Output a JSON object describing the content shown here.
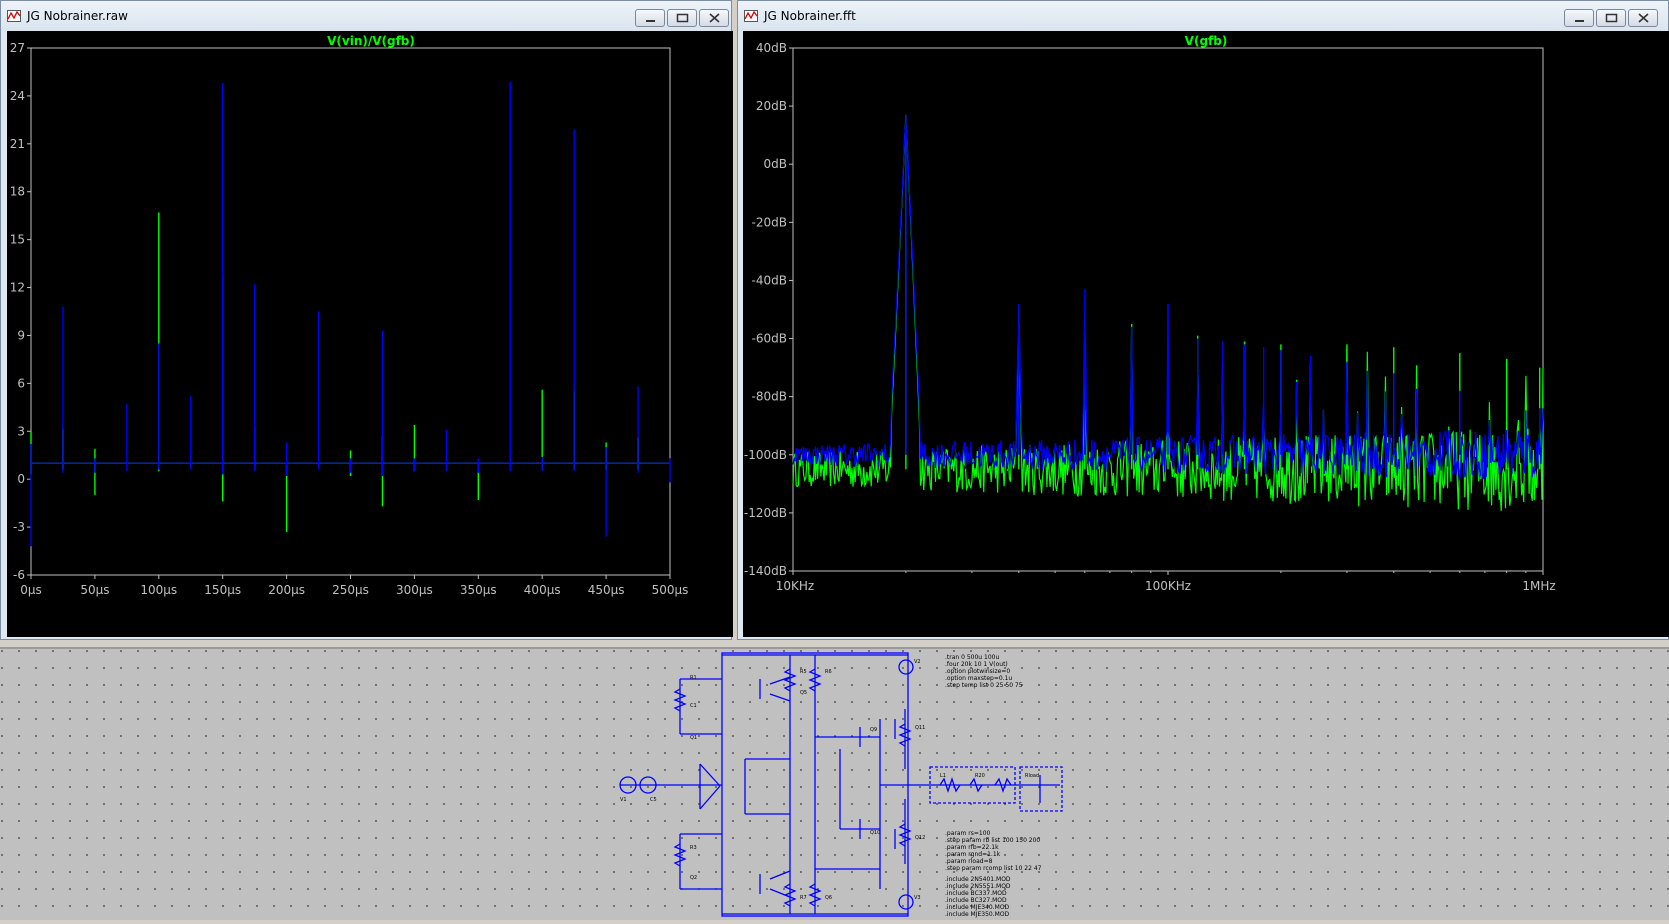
{
  "colors": {
    "plot_bg": "#000000",
    "axis": "#c0c0c0",
    "trace_green": "#00ff00",
    "trace_blue": "#0000ff",
    "wire": "#0000ff",
    "schematic_bg": "#c0c0c0"
  },
  "left_window": {
    "title": "JG Nobrainer.raw",
    "icon": "waveform-app-icon",
    "buttons": [
      "minimize-icon",
      "maximize-icon",
      "close-icon"
    ],
    "trace_label": "V(vin)/V(gfb)"
  },
  "right_window": {
    "title": "JG Nobrainer.fft",
    "icon": "waveform-app-icon",
    "buttons": [
      "minimize-icon",
      "maximize-icon",
      "close-icon"
    ],
    "trace_label": "V(gfb)"
  },
  "chart_data": [
    {
      "type": "line",
      "title": "V(vin)/V(gfb)",
      "x_ticks": [
        "0µs",
        "50µs",
        "100µs",
        "150µs",
        "200µs",
        "250µs",
        "300µs",
        "350µs",
        "400µs",
        "450µs",
        "500µs"
      ],
      "y_ticks": [
        "27",
        "24",
        "21",
        "18",
        "15",
        "12",
        "9",
        "6",
        "3",
        "0",
        "-3",
        "-6"
      ],
      "xlim": [
        0,
        500
      ],
      "ylim": [
        -6,
        27
      ],
      "baseline": 1.0,
      "series": [
        {
          "color": "#0000ff",
          "spikes": [
            {
              "x": 0,
              "high": 2.2,
              "low": -4.2
            },
            {
              "x": 25,
              "high": 10.8,
              "low": 0.4
            },
            {
              "x": 50,
              "high": 1.3,
              "low": 0.4
            },
            {
              "x": 75,
              "high": 4.7,
              "low": 0.5
            },
            {
              "x": 100,
              "high": 8.5,
              "low": 0.6
            },
            {
              "x": 125,
              "high": 5.2,
              "low": 0.6
            },
            {
              "x": 150,
              "high": 24.8,
              "low": 0.3
            },
            {
              "x": 175,
              "high": 12.2,
              "low": 0.5
            },
            {
              "x": 200,
              "high": 2.3,
              "low": 0.2
            },
            {
              "x": 225,
              "high": 10.5,
              "low": 0.6
            },
            {
              "x": 250,
              "high": 1.3,
              "low": 0.4
            },
            {
              "x": 275,
              "high": 9.3,
              "low": 0.2
            },
            {
              "x": 300,
              "high": 1.3,
              "low": 0.5
            },
            {
              "x": 325,
              "high": 3.1,
              "low": 0.5
            },
            {
              "x": 350,
              "high": 1.3,
              "low": 0.4
            },
            {
              "x": 375,
              "high": 24.9,
              "low": 0.5
            },
            {
              "x": 400,
              "high": 1.4,
              "low": 0.5
            },
            {
              "x": 425,
              "high": 21.9,
              "low": 0.5
            },
            {
              "x": 450,
              "high": 2.0,
              "low": -3.6
            },
            {
              "x": 475,
              "high": 5.8,
              "low": 0.4
            },
            {
              "x": 500,
              "high": 1.3,
              "low": -0.2
            }
          ]
        },
        {
          "color": "#00ff00",
          "spikes": [
            {
              "x": 0,
              "high": 3.0,
              "low": 0.3
            },
            {
              "x": 25,
              "high": 3.1,
              "low": 0.6
            },
            {
              "x": 50,
              "high": 1.9,
              "low": -1.0
            },
            {
              "x": 100,
              "high": 16.7,
              "low": 0.5
            },
            {
              "x": 150,
              "high": 12.8,
              "low": -1.4
            },
            {
              "x": 175,
              "high": 3.3,
              "low": 0.6
            },
            {
              "x": 200,
              "high": 0.9,
              "low": -3.3
            },
            {
              "x": 250,
              "high": 1.8,
              "low": 0.2
            },
            {
              "x": 275,
              "high": 2.7,
              "low": -1.7
            },
            {
              "x": 300,
              "high": 3.4,
              "low": 0.5
            },
            {
              "x": 350,
              "high": 1.1,
              "low": -1.3
            },
            {
              "x": 400,
              "high": 5.6,
              "low": 0.6
            },
            {
              "x": 425,
              "high": 5.5,
              "low": 0.6
            },
            {
              "x": 450,
              "high": 2.3,
              "low": 0.6
            },
            {
              "x": 475,
              "high": 2.6,
              "low": 0.6
            }
          ]
        }
      ]
    },
    {
      "type": "line",
      "title": "V(gfb)",
      "x_scale": "log",
      "x_ticks": [
        "10KHz",
        "100KHz",
        "1MHz"
      ],
      "y_ticks": [
        "40dB",
        "20dB",
        "0dB",
        "-20dB",
        "-40dB",
        "-60dB",
        "-80dB",
        "-100dB",
        "-120dB",
        "-140dB"
      ],
      "xlim": [
        10000,
        1000000
      ],
      "ylim": [
        -140,
        40
      ],
      "fundamental_hz": 20000,
      "series": [
        {
          "color": "#0000ff",
          "noise_floor_db": -100,
          "harmonics": [
            {
              "n": 1,
              "db": 17
            },
            {
              "n": 2,
              "db": -48
            },
            {
              "n": 3,
              "db": -43
            },
            {
              "n": 4,
              "db": -56
            },
            {
              "n": 5,
              "db": -48
            },
            {
              "n": 6,
              "db": -60
            },
            {
              "n": 7,
              "db": -61
            },
            {
              "n": 8,
              "db": -62
            },
            {
              "n": 9,
              "db": -63
            },
            {
              "n": 10,
              "db": -64
            },
            {
              "n": 12,
              "db": -66
            },
            {
              "n": 15,
              "db": -68
            },
            {
              "n": 20,
              "db": -72
            },
            {
              "n": 30,
              "db": -78
            },
            {
              "n": 49,
              "db": -84
            }
          ]
        },
        {
          "color": "#00ff00",
          "noise_floor_db": -105,
          "harmonics": [
            {
              "n": 1,
              "db": 17
            },
            {
              "n": 2,
              "db": -50
            },
            {
              "n": 3,
              "db": -76
            },
            {
              "n": 4,
              "db": -55
            },
            {
              "n": 5,
              "db": -70
            },
            {
              "n": 6,
              "db": -59
            },
            {
              "n": 8,
              "db": -61
            },
            {
              "n": 10,
              "db": -62
            },
            {
              "n": 15,
              "db": -62
            },
            {
              "n": 20,
              "db": -63
            },
            {
              "n": 30,
              "db": -65
            },
            {
              "n": 40,
              "db": -67
            },
            {
              "n": 49,
              "db": -70
            }
          ]
        }
      ]
    }
  ],
  "schematic": {
    "directives": [
      ".tran 0 500u 100u",
      ".four 20k 10 1 V(out)",
      ".option plotwinsize=0",
      ".option maxstep=0.1u",
      ".step temp list 0 25 50 75"
    ],
    "params": [
      ".param rs=100",
      ".step param rb list 100 150 200",
      ".param rfb=22.1k",
      ".param rgnd=1.1k",
      ".param rload=8",
      ".step param rcomp list 10 22 47"
    ],
    "includes": [
      ".include 2N5401.MOD",
      ".include 2N5551.MOD",
      ".include BC337.MOD",
      ".include BC327.MOD",
      ".include MJE340.MOD",
      ".include MJE350.MOD"
    ]
  }
}
